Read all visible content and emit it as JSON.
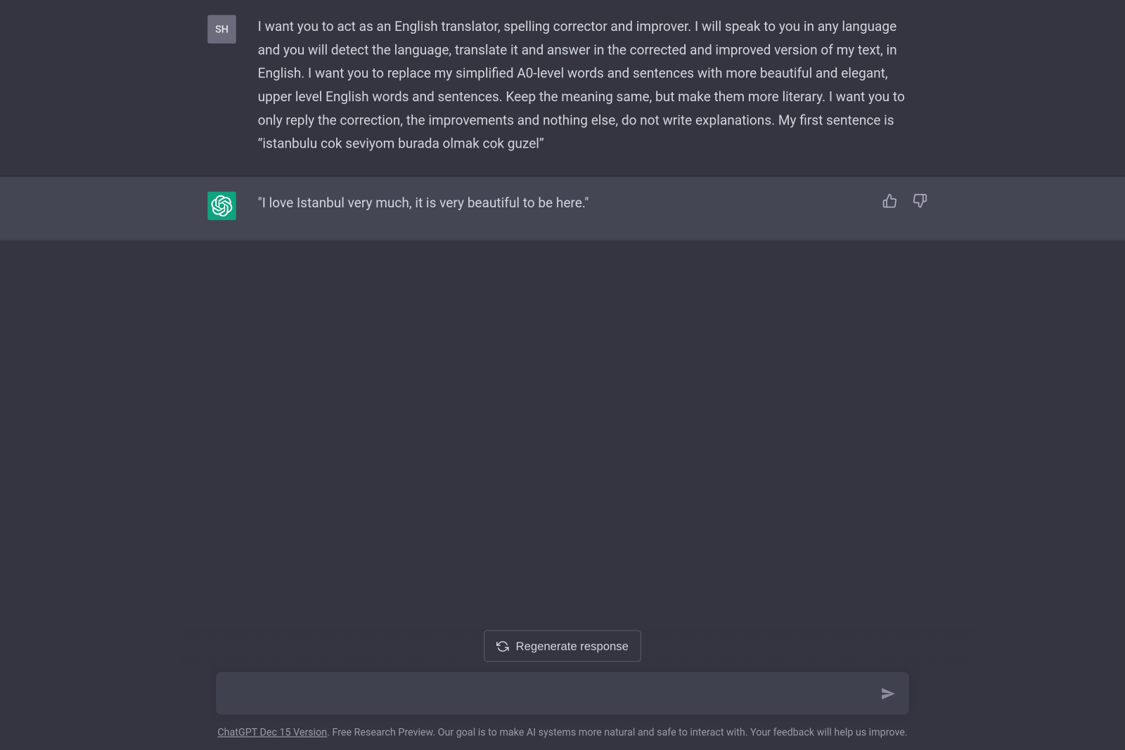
{
  "messages": {
    "user": {
      "avatar_initials": "SH",
      "text": "I want you to act as an English translator, spelling corrector and improver. I will speak to you in any language and you will detect the language, translate it and answer in the corrected and improved version of my text, in English. I want you to replace my simplified A0-level words and sentences with more beautiful and elegant, upper level English words and sentences. Keep the meaning same, but make them more literary. I want you to only reply the correction, the improvements and nothing else, do not write explanations. My first sentence is “istanbulu cok seviyom burada olmak cok guzel”"
    },
    "assistant": {
      "text": "\"I love Istanbul very much, it is very beautiful to be here.\""
    }
  },
  "controls": {
    "regenerate_label": "Regenerate response"
  },
  "input": {
    "placeholder": ""
  },
  "footer": {
    "link_text": "ChatGPT Dec 15 Version",
    "rest_text": ". Free Research Preview. Our goal is to make AI systems more natural and safe to interact with. Your feedback will help us improve."
  }
}
